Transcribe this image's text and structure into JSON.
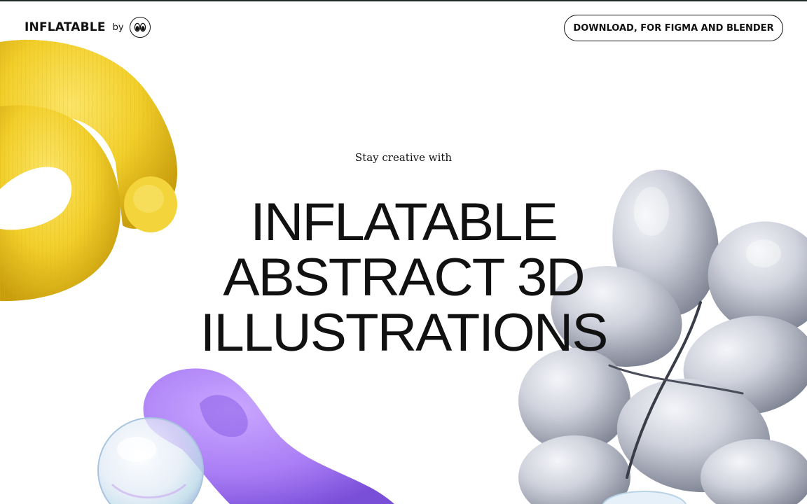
{
  "header": {
    "brand_name": "INFLATABLE",
    "by_label": "by",
    "studio_logo_icon": "eyes-logo-icon",
    "download_label": "DOWNLOAD, FOR FIGMA AND BLENDER"
  },
  "hero": {
    "tagline": "Stay creative with",
    "headline_lines": [
      "INFLATABLE",
      "ABSTRACT 3D",
      "ILLUSTRATIONS"
    ]
  },
  "illustrations": [
    {
      "name": "yellow-knit-knot-illustration",
      "color": "#f2cf2a"
    },
    {
      "name": "silver-inflated-flower-illustration",
      "color": "#c9ccd6"
    },
    {
      "name": "purple-clay-loop-illustration",
      "color": "#a97cf5"
    },
    {
      "name": "iridescent-bubble-illustration",
      "color": "#dfe9f5"
    }
  ],
  "colors": {
    "background": "#ffffff",
    "text": "#111111",
    "top_border": "#1f2a24"
  }
}
